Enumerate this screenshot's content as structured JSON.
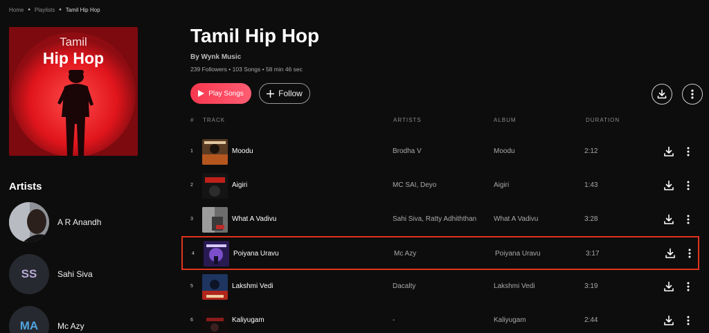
{
  "breadcrumb": {
    "home": "Home",
    "playlists": "Playlists",
    "current": "Tamil Hip Hop"
  },
  "cover": {
    "line1": "Tamil",
    "line2": "Hip Hop"
  },
  "playlist": {
    "title": "Tamil Hip Hop",
    "by": "By Wynk Music",
    "stats": "239 Followers • 103 Songs • 58 min 46 sec",
    "play_label": "Play Songs",
    "follow_label": "Follow"
  },
  "artists_heading": "Artists",
  "artists": [
    {
      "name": "A R Anandh",
      "initials": ""
    },
    {
      "name": "Sahi Siva",
      "initials": "SS"
    },
    {
      "name": "Mc Azy",
      "initials": "MA"
    }
  ],
  "table": {
    "headers": {
      "num": "#",
      "track": "TRACK",
      "artists": "ARTISTS",
      "album": "ALBUM",
      "duration": "DURATION"
    },
    "rows": [
      {
        "num": "1",
        "title": "Moodu",
        "artists": "Brodha V",
        "album": "Moodu",
        "duration": "2:12"
      },
      {
        "num": "2",
        "title": "Aigiri",
        "artists": "MC SAI, Deyo",
        "album": "Aigiri",
        "duration": "1:43"
      },
      {
        "num": "3",
        "title": "What A Vadivu",
        "artists": "Sahi Siva, Ratty Adhiththan",
        "album": "What A Vadivu",
        "duration": "3:28"
      },
      {
        "num": "4",
        "title": "Poiyana Uravu",
        "artists": "Mc Azy",
        "album": "Poiyana Uravu",
        "duration": "3:17",
        "selected": true
      },
      {
        "num": "5",
        "title": "Lakshmi Vedi",
        "artists": "Dacalty",
        "album": "Lakshmi Vedi",
        "duration": "3:19"
      },
      {
        "num": "6",
        "title": "Kaliyugam",
        "artists": "-",
        "album": "Kaliyugam",
        "duration": "2:44"
      }
    ]
  },
  "colors": {
    "accent": "#f7384f",
    "background": "#0d0d0d",
    "cover_red": "#c8141b",
    "selection": "#e0331d"
  },
  "icons": {
    "play": "play-icon",
    "follow": "plus-icon",
    "download": "download-icon",
    "more": "more-vertical-icon"
  }
}
